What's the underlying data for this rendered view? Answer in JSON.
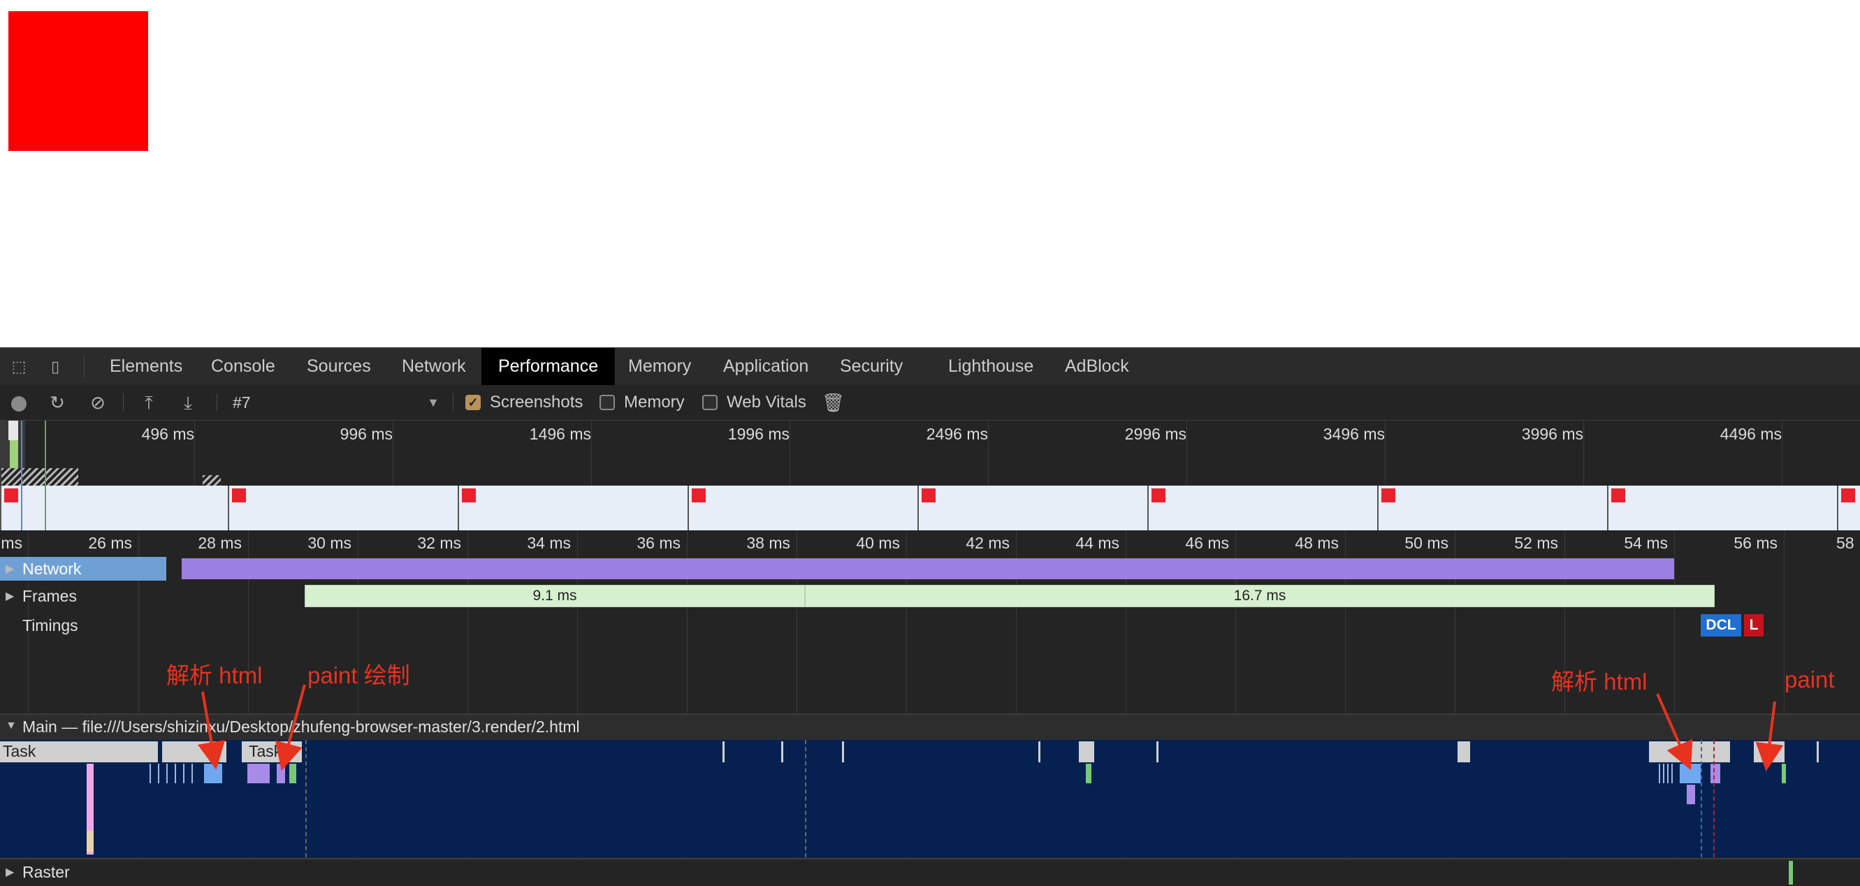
{
  "devtools": {
    "tabs": [
      "Elements",
      "Console",
      "Sources",
      "Network",
      "Performance",
      "Memory",
      "Application",
      "Security",
      "Lighthouse",
      "AdBlock"
    ],
    "active_tab": "Performance",
    "toolbar": {
      "profile": "#7",
      "screenshots_label": "Screenshots",
      "memory_label": "Memory",
      "web_vitals_label": "Web Vitals",
      "screenshots_checked": true,
      "memory_checked": false,
      "web_vitals_checked": false
    },
    "overview_labels": [
      "496 ms",
      "996 ms",
      "1496 ms",
      "1996 ms",
      "2496 ms",
      "2996 ms",
      "3496 ms",
      "3996 ms",
      "4496 ms"
    ],
    "ruler_labels": [
      "ms",
      "26 ms",
      "28 ms",
      "30 ms",
      "32 ms",
      "34 ms",
      "36 ms",
      "38 ms",
      "40 ms",
      "42 ms",
      "44 ms",
      "46 ms",
      "48 ms",
      "50 ms",
      "52 ms",
      "54 ms",
      "56 ms",
      "58"
    ],
    "tracks": {
      "network": "Network",
      "frames": "Frames",
      "frame1": "9.1 ms",
      "frame2": "16.7 ms",
      "timings": "Timings",
      "dcl": "DCL",
      "l": "L",
      "main": "Main — file:///Users/shizinxu/Desktop/zhufeng-browser-master/3.render/2.html",
      "task1": "Task",
      "task2": "Task",
      "raster": "Raster"
    },
    "colors": {
      "accent_active_tab": "#000000",
      "network_bar": "#9c7fe3",
      "frames_bar": "#d7f0cf",
      "dcl": "#1e6fd1",
      "load": "#c4141b",
      "flame_bg": "#06214f"
    }
  },
  "annotations": {
    "parse_html_1": "解析 html",
    "paint_1": "paint 绘制",
    "parse_html_2": "解析 html",
    "paint_2": "paint"
  }
}
